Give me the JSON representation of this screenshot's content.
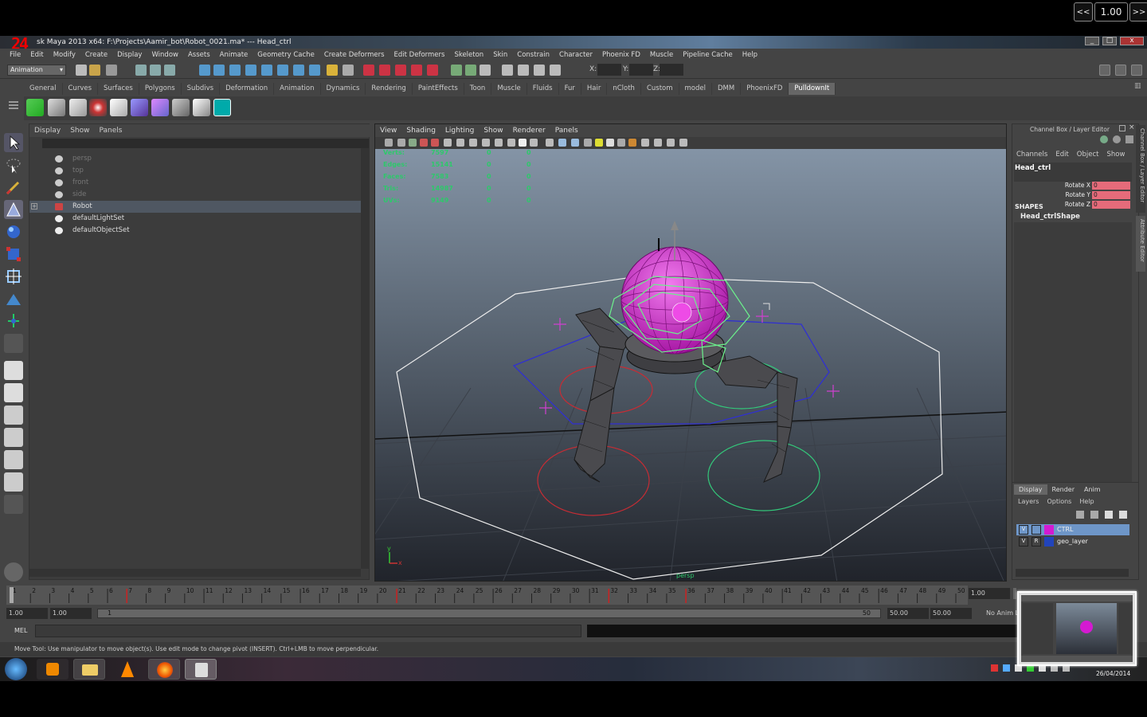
{
  "overlay": {
    "prev": "<<",
    "speed": "1.00",
    "next": ">>"
  },
  "window": {
    "logo": "24",
    "title": "sk Maya 2013 x64: F:\\Projects\\Aamir_bot\\Robot_0021.ma*  ---  Head_ctrl"
  },
  "menubar": [
    "File",
    "Edit",
    "Modify",
    "Create",
    "Display",
    "Window",
    "Assets",
    "Animate",
    "Geometry Cache",
    "Create Deformers",
    "Edit Deformers",
    "Skeleton",
    "Skin",
    "Constrain",
    "Character",
    "Phoenix FD",
    "Muscle",
    "Pipeline Cache",
    "Help"
  ],
  "statusline": {
    "mode": "Animation",
    "x_label": "X:",
    "y_label": "Y:",
    "z_label": "Z:"
  },
  "shelf_tabs": [
    "General",
    "Curves",
    "Surfaces",
    "Polygons",
    "Subdivs",
    "Deformation",
    "Animation",
    "Dynamics",
    "Rendering",
    "PaintEffects",
    "Toon",
    "Muscle",
    "Fluids",
    "Fur",
    "Hair",
    "nCloth",
    "Custom",
    "model",
    "DMM",
    "PhoenixFD",
    "PulldownIt"
  ],
  "shelf_active": "PulldownIt",
  "outliner": {
    "menu": [
      "Display",
      "Show",
      "Panels"
    ],
    "items": [
      {
        "label": "persp",
        "dim": true
      },
      {
        "label": "top",
        "dim": true
      },
      {
        "label": "front",
        "dim": true
      },
      {
        "label": "side",
        "dim": true
      },
      {
        "label": "Robot",
        "dim": false,
        "selected": true,
        "expander": "+"
      },
      {
        "label": "defaultLightSet",
        "dim": false
      },
      {
        "label": "defaultObjectSet",
        "dim": false
      }
    ]
  },
  "viewport": {
    "menu": [
      "View",
      "Shading",
      "Lighting",
      "Show",
      "Renderer",
      "Panels"
    ],
    "hud": [
      {
        "label": "Verts:",
        "v": [
          "7597",
          "0",
          "0"
        ]
      },
      {
        "label": "Edges:",
        "v": [
          "15141",
          "0",
          "0"
        ]
      },
      {
        "label": "Faces:",
        "v": [
          "7583",
          "0",
          "0"
        ]
      },
      {
        "label": "Tris:",
        "v": [
          "14987",
          "0",
          "0"
        ]
      },
      {
        "label": "UVs:",
        "v": [
          "9149",
          "0",
          "0"
        ]
      }
    ],
    "camera": "persp",
    "axis_x": "x",
    "axis_y": "y"
  },
  "channel_box": {
    "title": "Channel Box / Layer Editor",
    "menu": [
      "Channels",
      "Edit",
      "Object",
      "Show"
    ],
    "object": "Head_ctrl",
    "channels": [
      {
        "name": "Rotate X",
        "value": "0"
      },
      {
        "name": "Rotate Y",
        "value": "0"
      },
      {
        "name": "Rotate Z",
        "value": "0"
      }
    ],
    "shapes_label": "SHAPES",
    "shape": "Head_ctrlShape",
    "side_tab1": "Channel Box / Layer Editor",
    "side_tab2": "Attribute Editor"
  },
  "layer_editor": {
    "tabs": [
      "Display",
      "Render",
      "Anim"
    ],
    "menu": [
      "Layers",
      "Options",
      "Help"
    ],
    "layers": [
      {
        "v": "V",
        "r": "",
        "name": "CTRL",
        "color": "#d41ad1"
      },
      {
        "v": "V",
        "r": "R",
        "name": "geo_layer",
        "color": "#2244bb"
      }
    ]
  },
  "timeline": {
    "ticks": [
      "1",
      "2",
      "3",
      "4",
      "5",
      "6",
      "7",
      "8",
      "9",
      "10",
      "11",
      "12",
      "13",
      "14",
      "15",
      "16",
      "17",
      "18",
      "19",
      "20",
      "21",
      "22",
      "23",
      "24",
      "25",
      "26",
      "27",
      "28",
      "29",
      "30",
      "31",
      "32",
      "33",
      "34",
      "35",
      "36",
      "37",
      "38",
      "39",
      "40",
      "41",
      "42",
      "43",
      "44",
      "45",
      "46",
      "47",
      "48",
      "49",
      "50"
    ],
    "current_frame": "1.00"
  },
  "range": {
    "start_a": "1.00",
    "start_b": "1.00",
    "slider_start": "1",
    "slider_end": "50",
    "end_a": "50.00",
    "end_b": "50.00",
    "anim_layer": "No Anim L"
  },
  "cmdline": {
    "label": "MEL"
  },
  "helpline": "Move Tool: Use manipulator to move object(s). Use edit mode to change pivot (INSERT).  Ctrl+LMB to move perpendicular.",
  "taskbar": {
    "date": "26/04/2014"
  },
  "colors": {
    "accent": "#d41ad1",
    "hud": "#2ec86b",
    "channel_highlight": "#e56b7a"
  }
}
